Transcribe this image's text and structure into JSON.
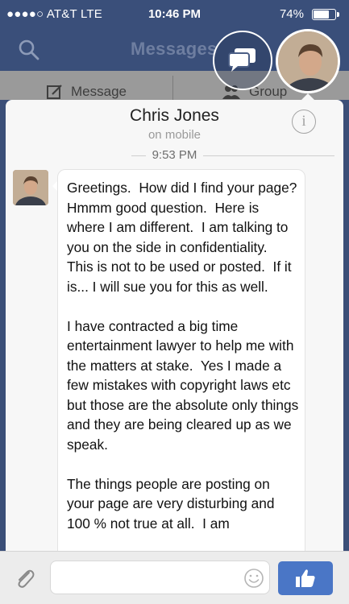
{
  "status_bar": {
    "carrier": "●●●●○ AT&T  LTE",
    "time": "10:46 PM",
    "battery": "74%",
    "battery_level": 0.74
  },
  "nav": {
    "title": "Messages",
    "search_icon": "search-icon"
  },
  "actions": {
    "message_label": "Message",
    "group_label": "Group"
  },
  "conversation": {
    "contact_name": "Chris Jones",
    "contact_status": "on mobile",
    "timestamp": "9:53 PM",
    "message": "Greetings.  How did I find your page?  Hmmm good question.  Here is where I am different.  I am talking to you on the side in confidentiality.  This is not to be used or posted.  If it is... I will sue you for this as well.\n\nI have contracted a big time entertainment lawyer to help me with the matters at stake.  Yes I made a few mistakes with copyright laws etc but those are the absolute only things and they are being cleared up as we speak.\n\nThe things people are posting on your page are very disturbing and 100 % not true at all.  I am"
  },
  "composer": {
    "placeholder": ""
  },
  "colors": {
    "nav_bg": "#3a4f7a",
    "like_button": "#4a76c6",
    "sheet_bg": "#f7f7f7"
  }
}
